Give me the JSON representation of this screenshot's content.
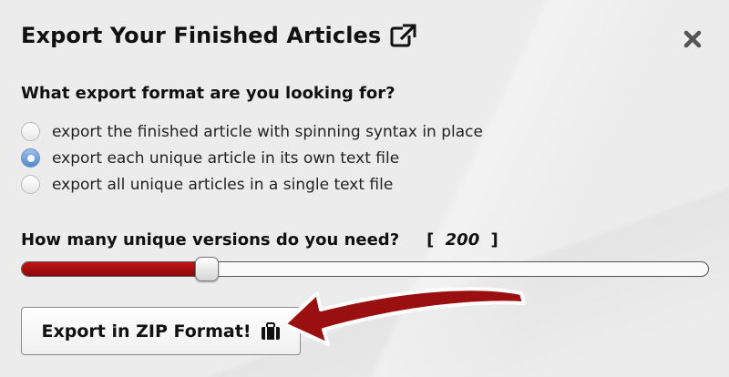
{
  "dialog": {
    "title": "Export Your Finished Articles",
    "close_icon": "close-icon"
  },
  "format_question": {
    "heading": "What export format are you looking for?",
    "options": [
      {
        "label": "export the finished article with spinning syntax in place",
        "selected": false
      },
      {
        "label": "export each unique article in its own text file",
        "selected": true
      },
      {
        "label": "export all unique articles in a single text file",
        "selected": false
      }
    ]
  },
  "versions": {
    "label": "How many unique versions do you need?",
    "bracket_open": "[",
    "value": "200",
    "bracket_close": "]",
    "slider_fraction": 0.27
  },
  "export_button": {
    "label": "Export in ZIP Format!",
    "icon": "briefcase-icon"
  },
  "colors": {
    "slider_fill": "#b01010",
    "arrow": "#9a0f0f",
    "radio_selected": "#5a8fcc"
  }
}
